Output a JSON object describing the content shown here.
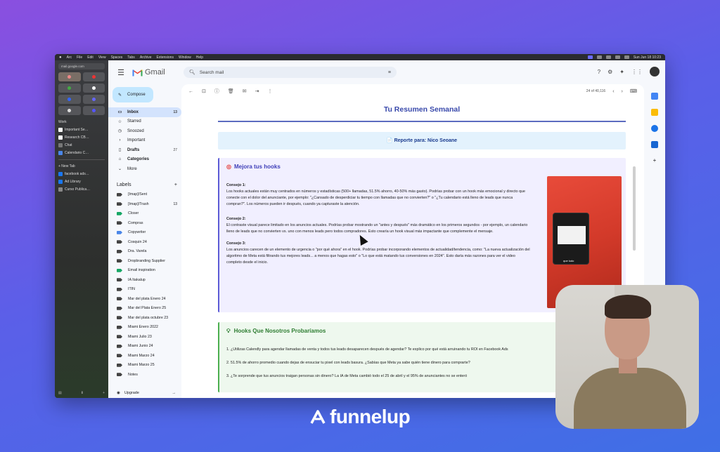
{
  "menubar": {
    "items": [
      "Arc",
      "File",
      "Edit",
      "View",
      "Spaces",
      "Tabs",
      "Archive",
      "Extensions",
      "Window",
      "Help"
    ],
    "clock": "Sun Jun 18  10:23"
  },
  "arc_sidebar": {
    "url": "mail.google.com",
    "items": [
      "Work",
      "Important Se…",
      "Research CB…",
      "Chat",
      "Calendario C…"
    ],
    "new_tab": "+ New Tab",
    "tabs": [
      "facebook ads…",
      "Ad Library",
      "Curso Publica…"
    ]
  },
  "gmail": {
    "app_name": "Gmail",
    "search_placeholder": "Search mail",
    "compose_label": "Compose",
    "nav": [
      {
        "label": "Inbox",
        "count": "13",
        "icon": "▭"
      },
      {
        "label": "Starred",
        "count": "",
        "icon": "☆"
      },
      {
        "label": "Snoozed",
        "count": "",
        "icon": "◷"
      },
      {
        "label": "Important",
        "count": "",
        "icon": "›"
      },
      {
        "label": "Drafts",
        "count": "27",
        "icon": "▯"
      },
      {
        "label": "Categories",
        "count": "",
        "icon": "⌂"
      },
      {
        "label": "More",
        "count": "",
        "icon": "⌄"
      }
    ],
    "labels_title": "Labels",
    "labels": [
      {
        "label": "[Imap]/Sent",
        "count": "",
        "color": "#444444"
      },
      {
        "label": "[Imap]/Trash",
        "count": "13",
        "color": "#444444"
      },
      {
        "label": "Closer",
        "count": "",
        "color": "#16a765"
      },
      {
        "label": "Compras",
        "count": "",
        "color": "#444444"
      },
      {
        "label": "Copywriter",
        "count": "",
        "color": "#4a86e8"
      },
      {
        "label": "Cosquin 24",
        "count": "",
        "color": "#444444"
      },
      {
        "label": "Dra. Varela",
        "count": "",
        "color": "#444444"
      },
      {
        "label": "Dropbranding Supplier",
        "count": "",
        "color": "#444444"
      },
      {
        "label": "Email inspiration",
        "count": "",
        "color": "#16a765"
      },
      {
        "label": "IA Itakalup",
        "count": "",
        "color": "#444444"
      },
      {
        "label": "ITIN",
        "count": "",
        "color": "#444444"
      },
      {
        "label": "Mar del plata Enero 24",
        "count": "",
        "color": "#444444"
      },
      {
        "label": "Mar del Plata Enero 25",
        "count": "",
        "color": "#444444"
      },
      {
        "label": "Mar del plata octubre 23",
        "count": "",
        "color": "#444444"
      },
      {
        "label": "Miami Enero 2022",
        "count": "",
        "color": "#444444"
      },
      {
        "label": "Miami Julio 23",
        "count": "",
        "color": "#444444"
      },
      {
        "label": "Miami Junio 24",
        "count": "",
        "color": "#444444"
      },
      {
        "label": "Miami Marzo 24",
        "count": "",
        "color": "#444444"
      },
      {
        "label": "Miami Marzo 25",
        "count": "",
        "color": "#444444"
      },
      {
        "label": "Notes",
        "count": "",
        "color": "#444444"
      }
    ],
    "upgrade_label": "Upgrade",
    "pager_text": "24 of 40,116"
  },
  "email": {
    "title": "Tu Resumen Semanal",
    "report": "📄 Reporte para: Nico Seoane",
    "section1_title": "Mejora tus hooks",
    "tips": [
      {
        "head": "Consejo 1:",
        "body": "Los hooks actuales están muy centrados en números y estadísticas (500+ llamadas, 51.5% ahorro, 40-50% más gasto). Podrías probar con un hook más emocional y directo que conecte con el dolor del anunciante, por ejemplo: \"¿Cansado de desperdiciar tu tiempo con llamadas que no convierten?\" o \"¿Tu calendario está lleno de leads que nunca compran?\". Los números pueden ir después, cuando ya capturaste la atención."
      },
      {
        "head": "Consejo 2:",
        "body": "El contraste visual parece limitado en los anuncios actuales. Podrías probar mostrando un \"antes y después\" más dramático en los primeros segundos - por ejemplo, un calendario lleno de leads que no convierten vs. uno con menos leads pero todos compradores. Esto crearía un hook visual más impactante que complemente el mensaje."
      },
      {
        "head": "Consejo 3:",
        "body": "Los anuncios carecen de un elemento de urgencia o \"por qué ahora\" en el hook. Podrías probar incorporando elementos de actualidad/tendencia, como: \"La nueva actualización del algoritmo de Meta está filtrando tus mejores leads... a menos que hagas esto\" o \"Lo que está matando tus conversiones en 2024\". Esto daría más razones para ver el video completo desde el inicio."
      }
    ],
    "thumb_caption": "que ludo",
    "section2_title": "Hooks Que Nosotros Probaríamos",
    "hooks": [
      "1. ¿Utilizas Calendly para agendar llamadas de venta y todos tus leads desaparecen después de agendar? Te explico por qué está arruinando tu ROI en Facebook Ads",
      "2. 51.5% de ahorro promedio cuando dejas de ensuciar tu pixel con leads basura. ¿Sabías que Meta ya sabe quién tiene dinero para comprarte?",
      "3. ¿Te sorprende que tus anuncios traigan personas sin dinero? La IA de Meta cambió todo el 25 de abril y el 95% de anunciantes no se enteró"
    ]
  },
  "brand": {
    "name": "funnelup"
  },
  "colors": {
    "accent": "#3949ab",
    "compose_bg": "#c2e7ff",
    "inbox_active": "#d3e3fd",
    "section1_bg": "#f1efff",
    "section2_bg": "#eef8ee"
  }
}
